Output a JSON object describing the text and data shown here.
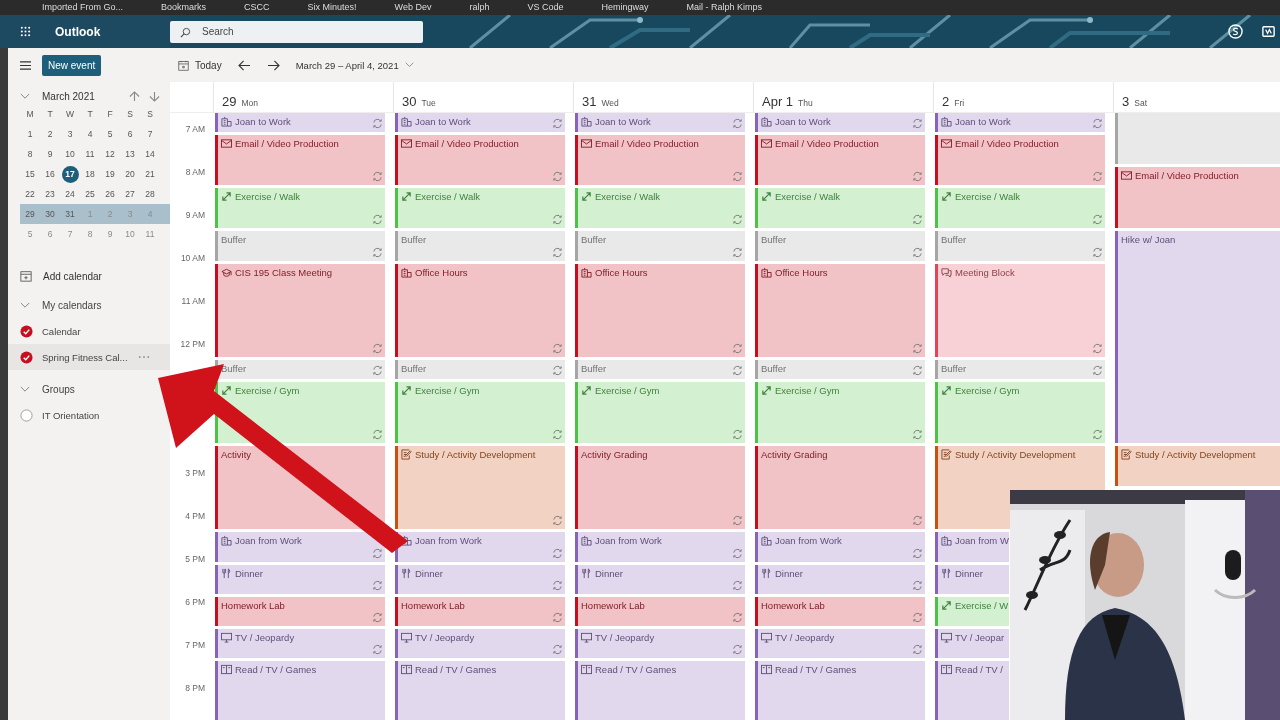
{
  "bookmarks": [
    "Imported From Go...",
    "Bookmarks",
    "CSCC",
    "Six Minutes!",
    "Web Dev",
    "ralph",
    "VS Code",
    "Hemingway",
    "Mail - Ralph Kimps"
  ],
  "app": {
    "name": "Outlook",
    "search_placeholder": "Search"
  },
  "commands": {
    "new_event": "New event",
    "today": "Today",
    "range": "March 29 – April 4, 2021"
  },
  "mini_calendar": {
    "title": "March 2021",
    "weekdays": [
      "M",
      "T",
      "W",
      "T",
      "F",
      "S",
      "S"
    ],
    "weeks": [
      {
        "selected": false,
        "days": [
          {
            "label": "1",
            "today": false,
            "other_month": false
          },
          {
            "label": "2",
            "today": false,
            "other_month": false
          },
          {
            "label": "3",
            "today": false,
            "other_month": false
          },
          {
            "label": "4",
            "today": false,
            "other_month": false
          },
          {
            "label": "5",
            "today": false,
            "other_month": false
          },
          {
            "label": "6",
            "today": false,
            "other_month": false
          },
          {
            "label": "7",
            "today": false,
            "other_month": false
          }
        ]
      },
      {
        "selected": false,
        "days": [
          {
            "label": "8",
            "today": false,
            "other_month": false
          },
          {
            "label": "9",
            "today": false,
            "other_month": false
          },
          {
            "label": "10",
            "today": false,
            "other_month": false
          },
          {
            "label": "11",
            "today": false,
            "other_month": false
          },
          {
            "label": "12",
            "today": false,
            "other_month": false
          },
          {
            "label": "13",
            "today": false,
            "other_month": false
          },
          {
            "label": "14",
            "today": false,
            "other_month": false
          }
        ]
      },
      {
        "selected": false,
        "days": [
          {
            "label": "15",
            "today": false,
            "other_month": false
          },
          {
            "label": "16",
            "today": false,
            "other_month": false
          },
          {
            "label": "17",
            "today": true,
            "other_month": false
          },
          {
            "label": "18",
            "today": false,
            "other_month": false
          },
          {
            "label": "19",
            "today": false,
            "other_month": false
          },
          {
            "label": "20",
            "today": false,
            "other_month": false
          },
          {
            "label": "21",
            "today": false,
            "other_month": false
          }
        ]
      },
      {
        "selected": false,
        "days": [
          {
            "label": "22",
            "today": false,
            "other_month": false
          },
          {
            "label": "23",
            "today": false,
            "other_month": false
          },
          {
            "label": "24",
            "today": false,
            "other_month": false
          },
          {
            "label": "25",
            "today": false,
            "other_month": false
          },
          {
            "label": "26",
            "today": false,
            "other_month": false
          },
          {
            "label": "27",
            "today": false,
            "other_month": false
          },
          {
            "label": "28",
            "today": false,
            "other_month": false
          }
        ]
      },
      {
        "selected": true,
        "days": [
          {
            "label": "29",
            "today": false,
            "other_month": false
          },
          {
            "label": "30",
            "today": false,
            "other_month": false
          },
          {
            "label": "31",
            "today": false,
            "other_month": false
          },
          {
            "label": "1",
            "today": false,
            "other_month": true
          },
          {
            "label": "2",
            "today": false,
            "other_month": true
          },
          {
            "label": "3",
            "today": false,
            "other_month": true
          },
          {
            "label": "4",
            "today": false,
            "other_month": true
          }
        ]
      },
      {
        "selected": false,
        "days": [
          {
            "label": "5",
            "today": false,
            "other_month": true
          },
          {
            "label": "6",
            "today": false,
            "other_month": true
          },
          {
            "label": "7",
            "today": false,
            "other_month": true
          },
          {
            "label": "8",
            "today": false,
            "other_month": true
          },
          {
            "label": "9",
            "today": false,
            "other_month": true
          },
          {
            "label": "10",
            "today": false,
            "other_month": true
          },
          {
            "label": "11",
            "today": false,
            "other_month": true
          }
        ]
      }
    ]
  },
  "add_calendar": "Add calendar",
  "groups": [
    {
      "title": "My calendars",
      "expanded": true,
      "items": [
        {
          "name": "Calendar",
          "checked": true,
          "hovered": false
        },
        {
          "name": "Spring Fitness Cal...",
          "checked": true,
          "hovered": true
        }
      ]
    },
    {
      "title": "Groups",
      "expanded": true,
      "items": [
        {
          "name": "IT Orientation",
          "checked": false,
          "hovered": false
        }
      ]
    }
  ],
  "times": [
    "7 AM",
    "8 AM",
    "9 AM",
    "10 AM",
    "11 AM",
    "12 PM",
    "3 PM",
    "4 PM",
    "5 PM",
    "6 PM",
    "7 PM",
    "8 PM"
  ],
  "days": [
    {
      "date": "29",
      "weekday": "Mon",
      "events": [
        {
          "title": "Joan to Work",
          "kind": "office",
          "color": "#8764b8",
          "recurring": true
        },
        {
          "title": "Email / Video Production",
          "kind": "mail",
          "color": "#c50f1f",
          "recurring": true
        },
        {
          "title": "Exercise / Walk",
          "kind": "exercise",
          "color": "#4dc247",
          "recurring": true
        },
        {
          "title": "Buffer",
          "kind": "plain",
          "color": "#a6a6a6",
          "recurring": true
        },
        {
          "title": "CIS 195 Class Meeting",
          "kind": "cap",
          "color": "#c50f1f",
          "recurring": true
        },
        {
          "title": "Buffer",
          "kind": "plain",
          "color": "#a6a6a6",
          "recurring": true
        },
        {
          "title": "Exercise / Gym",
          "kind": "exercise",
          "color": "#4dc247",
          "recurring": true
        },
        {
          "title": "Activity",
          "kind": "plain",
          "color": "#c50f1f",
          "recurring": false
        },
        {
          "title": "Joan from Work",
          "kind": "office",
          "color": "#8764b8",
          "recurring": true
        },
        {
          "title": "Dinner",
          "kind": "dinner",
          "color": "#8764b8",
          "recurring": true
        },
        {
          "title": "Homework Lab",
          "kind": "plain",
          "color": "#c50f1f",
          "recurring": true
        },
        {
          "title": "TV / Jeopardy",
          "kind": "tv",
          "color": "#8764b8",
          "recurring": true
        },
        {
          "title": "Read / TV / Games",
          "kind": "book",
          "color": "#8764b8",
          "recurring": false
        }
      ]
    },
    {
      "date": "30",
      "weekday": "Tue",
      "events": [
        {
          "title": "Joan to Work",
          "kind": "office",
          "color": "#8764b8",
          "recurring": true
        },
        {
          "title": "Email / Video Production",
          "kind": "mail",
          "color": "#c50f1f",
          "recurring": true
        },
        {
          "title": "Exercise / Walk",
          "kind": "exercise",
          "color": "#4dc247",
          "recurring": true
        },
        {
          "title": "Buffer",
          "kind": "plain",
          "color": "#a6a6a6",
          "recurring": true
        },
        {
          "title": "Office Hours",
          "kind": "office",
          "color": "#c50f1f",
          "recurring": true
        },
        {
          "title": "Buffer",
          "kind": "plain",
          "color": "#a6a6a6",
          "recurring": true
        },
        {
          "title": "Exercise / Gym",
          "kind": "exercise",
          "color": "#4dc247",
          "recurring": true
        },
        {
          "title": "Study / Activity Development",
          "kind": "study",
          "color": "#ca5010",
          "recurring": true
        },
        {
          "title": "Joan from Work",
          "kind": "office",
          "color": "#8764b8",
          "recurring": true
        },
        {
          "title": "Dinner",
          "kind": "dinner",
          "color": "#8764b8",
          "recurring": true
        },
        {
          "title": "Homework Lab",
          "kind": "plain",
          "color": "#c50f1f",
          "recurring": true
        },
        {
          "title": "TV / Jeopardy",
          "kind": "tv",
          "color": "#8764b8",
          "recurring": true
        },
        {
          "title": "Read / TV / Games",
          "kind": "book",
          "color": "#8764b8",
          "recurring": false
        }
      ]
    },
    {
      "date": "31",
      "weekday": "Wed",
      "events": [
        {
          "title": "Joan to Work",
          "kind": "office",
          "color": "#8764b8",
          "recurring": true
        },
        {
          "title": "Email / Video Production",
          "kind": "mail",
          "color": "#c50f1f",
          "recurring": true
        },
        {
          "title": "Exercise / Walk",
          "kind": "exercise",
          "color": "#4dc247",
          "recurring": true
        },
        {
          "title": "Buffer",
          "kind": "plain",
          "color": "#a6a6a6",
          "recurring": true
        },
        {
          "title": "Office Hours",
          "kind": "office",
          "color": "#c50f1f",
          "recurring": true
        },
        {
          "title": "Buffer",
          "kind": "plain",
          "color": "#a6a6a6",
          "recurring": true
        },
        {
          "title": "Exercise / Gym",
          "kind": "exercise",
          "color": "#4dc247",
          "recurring": true
        },
        {
          "title": "Activity Grading",
          "kind": "plain",
          "color": "#c50f1f",
          "recurring": true
        },
        {
          "title": "Joan from Work",
          "kind": "office",
          "color": "#8764b8",
          "recurring": true
        },
        {
          "title": "Dinner",
          "kind": "dinner",
          "color": "#8764b8",
          "recurring": true
        },
        {
          "title": "Homework Lab",
          "kind": "plain",
          "color": "#c50f1f",
          "recurring": true
        },
        {
          "title": "TV / Jeopardy",
          "kind": "tv",
          "color": "#8764b8",
          "recurring": true
        },
        {
          "title": "Read / TV / Games",
          "kind": "book",
          "color": "#8764b8",
          "recurring": false
        }
      ]
    },
    {
      "date": "Apr 1",
      "weekday": "Thu",
      "events": [
        {
          "title": "Joan to Work",
          "kind": "office",
          "color": "#8764b8",
          "recurring": true
        },
        {
          "title": "Email / Video Production",
          "kind": "mail",
          "color": "#c50f1f",
          "recurring": true
        },
        {
          "title": "Exercise / Walk",
          "kind": "exercise",
          "color": "#4dc247",
          "recurring": true
        },
        {
          "title": "Buffer",
          "kind": "plain",
          "color": "#a6a6a6",
          "recurring": true
        },
        {
          "title": "Office Hours",
          "kind": "office",
          "color": "#c50f1f",
          "recurring": true
        },
        {
          "title": "Buffer",
          "kind": "plain",
          "color": "#a6a6a6",
          "recurring": true
        },
        {
          "title": "Exercise / Gym",
          "kind": "exercise",
          "color": "#4dc247",
          "recurring": true
        },
        {
          "title": "Activity Grading",
          "kind": "plain",
          "color": "#c50f1f",
          "recurring": true
        },
        {
          "title": "Joan from Work",
          "kind": "office",
          "color": "#8764b8",
          "recurring": true
        },
        {
          "title": "Dinner",
          "kind": "dinner",
          "color": "#8764b8",
          "recurring": true
        },
        {
          "title": "Homework Lab",
          "kind": "plain",
          "color": "#c50f1f",
          "recurring": true
        },
        {
          "title": "TV / Jeopardy",
          "kind": "tv",
          "color": "#8764b8",
          "recurring": true
        },
        {
          "title": "Read / TV / Games",
          "kind": "book",
          "color": "#8764b8",
          "recurring": false
        }
      ]
    },
    {
      "date": "2",
      "weekday": "Fri",
      "events": [
        {
          "title": "Joan to Work",
          "kind": "office",
          "color": "#8764b8",
          "recurring": true
        },
        {
          "title": "Email / Video Production",
          "kind": "mail",
          "color": "#c50f1f",
          "recurring": true
        },
        {
          "title": "Exercise / Walk",
          "kind": "exercise",
          "color": "#4dc247",
          "recurring": true
        },
        {
          "title": "Buffer",
          "kind": "plain",
          "color": "#a6a6a6",
          "recurring": true
        },
        {
          "title": "Meeting Block",
          "kind": "meeting",
          "color": "#e04657",
          "recurring": true
        },
        {
          "title": "Buffer",
          "kind": "plain",
          "color": "#a6a6a6",
          "recurring": true
        },
        {
          "title": "Exercise / Gym",
          "kind": "exercise",
          "color": "#4dc247",
          "recurring": true
        },
        {
          "title": "Study / Activity Development",
          "kind": "study",
          "color": "#ca5010",
          "recurring": false
        },
        {
          "title": "Joan from W",
          "kind": "office",
          "color": "#8764b8",
          "recurring": false
        },
        {
          "title": "Dinner",
          "kind": "dinner",
          "color": "#8764b8",
          "recurring": false
        },
        {
          "title": "Exercise / W",
          "kind": "exercise",
          "color": "#4dc247",
          "recurring": false
        },
        {
          "title": "TV / Jeopar",
          "kind": "tv",
          "color": "#8764b8",
          "recurring": false
        },
        {
          "title": "Read / TV /",
          "kind": "book",
          "color": "#8764b8",
          "recurring": false
        }
      ]
    },
    {
      "date": "3",
      "weekday": "Sat",
      "events": [
        {
          "kind": "plain",
          "color": "#a6a6a6",
          "recurring": false
        },
        {
          "title": "Email / Video Production",
          "kind": "mail",
          "color": "#c50f1f",
          "recurring": false
        },
        {
          "title": "Hike w/ Joan",
          "kind": "plain",
          "color": "#8764b8",
          "recurring": false
        },
        {
          "title": "Study / Activity Development",
          "kind": "study",
          "color": "#ca5010",
          "recurring": false
        }
      ]
    }
  ]
}
